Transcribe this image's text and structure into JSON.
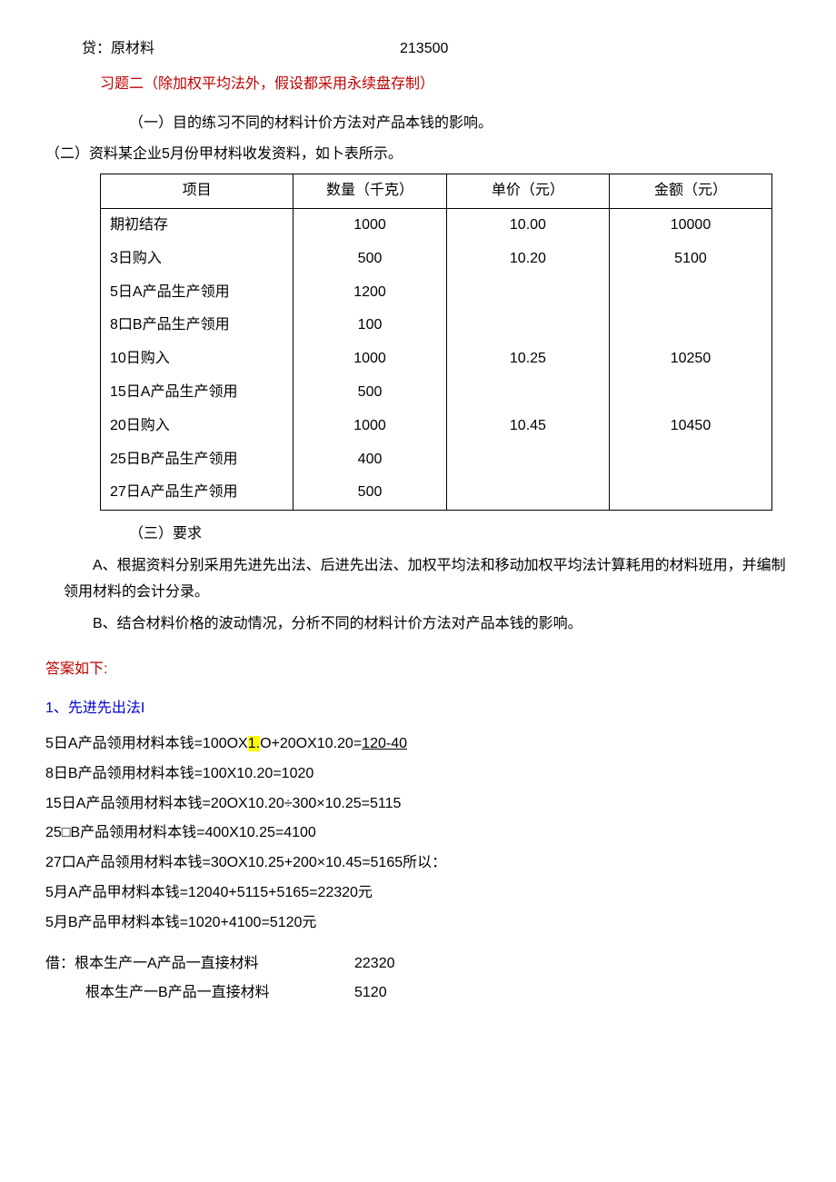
{
  "entry_top": {
    "label": "贷：原材料",
    "amount": "213500"
  },
  "title2": "习题二（除加权平均法外，假设都采用永续盘存制）",
  "purpose": "（一）目的练习不同的材料计价方法对产品本钱的影响。",
  "data_intro": "（二）资料某企业5月份甲材料收发资料，如卜表所示。",
  "table": {
    "headers": [
      "项目",
      "数量（千克）",
      "单价（元）",
      "金额（元）"
    ],
    "rows": [
      {
        "item": "期初结存",
        "qty": "1000",
        "price": "10.00",
        "amt": "10000"
      },
      {
        "item": "3日购入",
        "qty": "500",
        "price": "10.20",
        "amt": "5100"
      },
      {
        "item": "5日A产品生产领用",
        "qty": "1200",
        "price": "",
        "amt": ""
      },
      {
        "item": "8口B产品生产领用",
        "qty": "100",
        "price": "",
        "amt": ""
      },
      {
        "item": "10日购入",
        "qty": "1000",
        "price": "10.25",
        "amt": "10250"
      },
      {
        "item": "15日A产品生产领用",
        "qty": "500",
        "price": "",
        "amt": ""
      },
      {
        "item": "20日购入",
        "qty": "1000",
        "price": "10.45",
        "amt": "10450"
      },
      {
        "item": "25日B产品生产领用",
        "qty": "400",
        "price": "",
        "amt": ""
      },
      {
        "item": "27日A产品生产领用",
        "qty": "500",
        "price": "",
        "amt": ""
      }
    ]
  },
  "req_head": "（三）要求",
  "req_a": "A、根据资料分别采用先进先出法、后进先出法、加权平均法和移动加权平均法计算耗用的材料班用，并编制领用材料的会计分录。",
  "req_b": "B、结合材料价格的波动情况，分析不同的材料计价方法对产品本钱的影响。",
  "answer_label": "答案如下:",
  "method1_label": "1、先进先出法I",
  "calc": {
    "l1a": "5日A产品领用材料本钱=100OX",
    "l1b": "1.",
    "l1c": "O+20OX10.20=",
    "l1d": "120-40",
    "l2": "8日B产品领用材料本钱=100X10.20=1020",
    "l3": "15日A产品领用材料本钱=20OX10.20÷300×10.25=5115",
    "l4": "25□B产品领用材料本钱=400X10.25=4100",
    "l5": "27口A产品领用材料本钱=30OX10.25+200×10.45=5165所以：",
    "l6": "5月A产品甲材料本钱=12040+5115+5165=22320元",
    "l7": "5月B产品甲材料本钱=1020+4100=5120元"
  },
  "je": {
    "r1_lbl": "借：根本生产一A产品一直接材料",
    "r1_amt": "22320",
    "r2_lbl": "根本生产一B产品一直接材料",
    "r2_amt": "5120"
  }
}
